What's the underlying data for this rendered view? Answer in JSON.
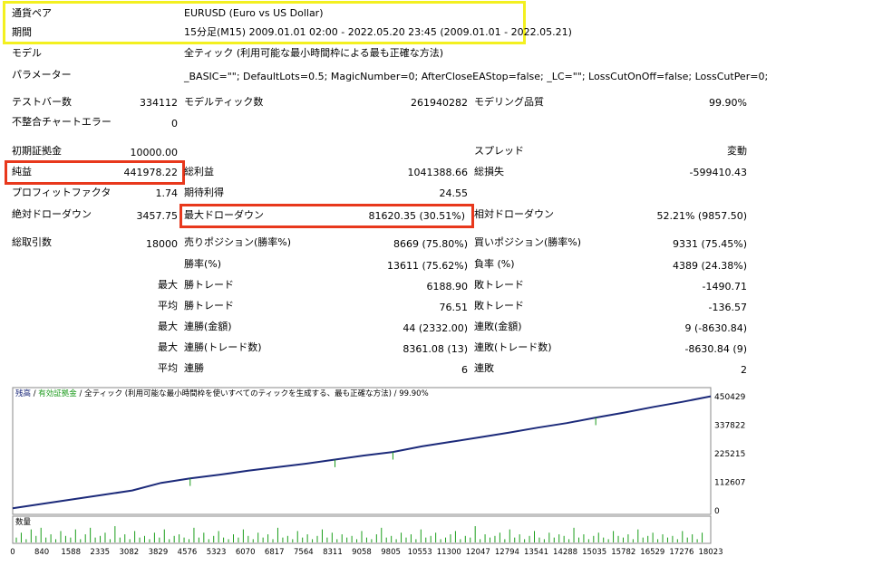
{
  "summary": {
    "pair_label": "通貨ペア",
    "pair_value": "EURUSD (Euro vs US Dollar)",
    "period_label": "期間",
    "period_value": "15分足(M15) 2009.01.01 02:00 - 2022.05.20 23:45 (2009.01.01 - 2022.05.21)",
    "model_label": "モデル",
    "model_value": "全ティック (利用可能な最小時間枠による最も正確な方法)",
    "params_label": "パラメーター",
    "params_value": "_BASIC=\"\"; DefaultLots=0.5; MagicNumber=0; AfterCloseEAStop=false; _LC=\"\"; LossCutOnOff=false; LossCutPer=0;",
    "bars_label": "テストバー数",
    "bars_value": "334112",
    "ticks_label": "モデルティック数",
    "ticks_value": "261940282",
    "quality_label": "モデリング品質",
    "quality_value": "99.90%",
    "mismatch_label": "不整合チャートエラー",
    "mismatch_value": "0"
  },
  "stats": {
    "deposit_label": "初期証拠金",
    "deposit_value": "10000.00",
    "spread_label": "スプレッド",
    "spread_value": "変動",
    "net_label": "純益",
    "net_value": "441978.22",
    "gross_profit_label": "総利益",
    "gross_profit_value": "1041388.66",
    "gross_loss_label": "総損失",
    "gross_loss_value": "-599410.43",
    "pf_label": "プロフィットファクタ",
    "pf_value": "1.74",
    "expected_label": "期待利得",
    "expected_value": "24.55",
    "abs_dd_label": "絶対ドローダウン",
    "abs_dd_value": "3457.75",
    "max_dd_label": "最大ドローダウン",
    "max_dd_value": "81620.35 (30.51%)",
    "rel_dd_label": "相対ドローダウン",
    "rel_dd_value": "52.21% (9857.50)",
    "trades_label": "総取引数",
    "trades_value": "18000",
    "short_label": "売りポジション(勝率%)",
    "short_value": "8669 (75.80%)",
    "long_label": "買いポジション(勝率%)",
    "long_value": "9331 (75.45%)",
    "win_pct_label": "勝率(%)",
    "win_pct_value": "13611 (75.62%)",
    "loss_pct_label": "負率 (%)",
    "loss_pct_value": "4389 (24.38%)",
    "max_label": "最大",
    "avg_label": "平均",
    "max_win_label": "勝トレード",
    "max_win_value": "6188.90",
    "max_loss_label": "敗トレード",
    "max_loss_value": "-1490.71",
    "avg_win_label": "勝トレード",
    "avg_win_value": "76.51",
    "avg_loss_label": "敗トレード",
    "avg_loss_value": "-136.57",
    "max_consec_win_money_label": "連勝(金額)",
    "max_consec_win_money_value": "44 (2332.00)",
    "max_consec_loss_money_label": "連敗(金額)",
    "max_consec_loss_money_value": "9 (-8630.84)",
    "max_consec_win_trades_label": "連勝(トレード数)",
    "max_consec_win_trades_value": "8361.08 (13)",
    "max_consec_loss_trades_label": "連敗(トレード数)",
    "max_consec_loss_trades_value": "-8630.84 (9)",
    "avg_consec_win_label": "連勝",
    "avg_consec_win_value": "6",
    "avg_consec_loss_label": "連敗",
    "avg_consec_loss_value": "2"
  },
  "chart_data": {
    "type": "line",
    "legend": {
      "balance": "残高",
      "sep": " / ",
      "equity": "有効証拠金",
      "rest": " / 全ティック (利用可能な最小時間枠を使いすべてのティックを生成する、最も正確な方法) / 99.90%"
    },
    "colors": {
      "balance": "#1c2a7a",
      "equity": "#1b9a1b",
      "volume": "#1a9e1a"
    },
    "ylim": [
      0,
      450429
    ],
    "yticks": [
      "450429",
      "337822",
      "225215",
      "112607",
      "0"
    ],
    "xlim": [
      0,
      18000
    ],
    "xticks": [
      "0",
      "840",
      "1588",
      "2335",
      "3082",
      "3829",
      "4576",
      "5323",
      "6070",
      "6817",
      "7564",
      "8311",
      "9058",
      "9805",
      "10553",
      "11300",
      "12047",
      "12794",
      "13541",
      "14288",
      "15035",
      "15782",
      "16529",
      "17276",
      "18023"
    ],
    "balance": [
      [
        0,
        10000
      ],
      [
        840,
        29000
      ],
      [
        1588,
        46000
      ],
      [
        2335,
        63000
      ],
      [
        3082,
        80000
      ],
      [
        3829,
        110000
      ],
      [
        4576,
        128000
      ],
      [
        5323,
        142000
      ],
      [
        6070,
        158000
      ],
      [
        6817,
        172000
      ],
      [
        7564,
        186000
      ],
      [
        8311,
        202000
      ],
      [
        9058,
        218000
      ],
      [
        9805,
        232000
      ],
      [
        10553,
        254000
      ],
      [
        11300,
        272000
      ],
      [
        12047,
        290000
      ],
      [
        12794,
        308000
      ],
      [
        13541,
        328000
      ],
      [
        14288,
        346000
      ],
      [
        15035,
        368000
      ],
      [
        15782,
        388000
      ],
      [
        16529,
        410000
      ],
      [
        17276,
        430000
      ],
      [
        18000,
        452000
      ]
    ],
    "volume_label": "数量",
    "volume": [
      3,
      6,
      2,
      8,
      4,
      9,
      3,
      5,
      2,
      7,
      4,
      3,
      8,
      2,
      5,
      9,
      3,
      4,
      6,
      2,
      10,
      3,
      5,
      2,
      7,
      3,
      4,
      2,
      6,
      3,
      8,
      2,
      4,
      5,
      3,
      2,
      9,
      3,
      6,
      2,
      4,
      7,
      3,
      2,
      5,
      3,
      8,
      4,
      2,
      6,
      3,
      5,
      2,
      9,
      3,
      4,
      2,
      7,
      3,
      5,
      2,
      4,
      8,
      3,
      6,
      2,
      5,
      3,
      4,
      2,
      7,
      3,
      2,
      5,
      9,
      3,
      4,
      2,
      6,
      3,
      5,
      2,
      8,
      3,
      4,
      6,
      2,
      3,
      5,
      7,
      2,
      4,
      3,
      10,
      2,
      5,
      3,
      4,
      6,
      2,
      8,
      3,
      5,
      2,
      4,
      7,
      3,
      2,
      6,
      3,
      5,
      4,
      2,
      9,
      3,
      5,
      2,
      4,
      6,
      3,
      2,
      7,
      4,
      3,
      5,
      2,
      8,
      3,
      4,
      6,
      2,
      5,
      3,
      4,
      2,
      7,
      3,
      5,
      2,
      6
    ]
  }
}
